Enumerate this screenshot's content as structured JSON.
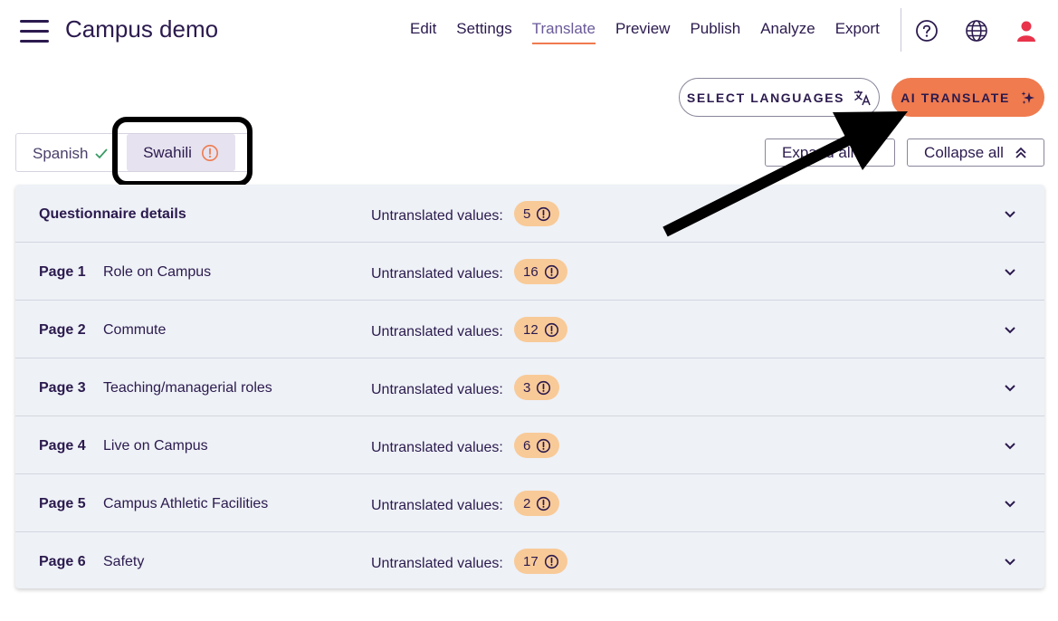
{
  "app": {
    "title": "Campus demo"
  },
  "nav": {
    "items": [
      {
        "label": "Edit"
      },
      {
        "label": "Settings"
      },
      {
        "label": "Translate",
        "active": true
      },
      {
        "label": "Preview"
      },
      {
        "label": "Publish"
      },
      {
        "label": "Analyze"
      },
      {
        "label": "Export"
      }
    ],
    "icons": [
      "help-icon",
      "globe-icon",
      "user-icon"
    ]
  },
  "actions": {
    "select_languages": "SELECT LANGUAGES",
    "ai_translate": "AI TRANSLATE"
  },
  "languages": {
    "tabs": [
      {
        "label": "Spanish",
        "status": "complete"
      },
      {
        "label": "Swahili",
        "status": "warning",
        "selected": true
      }
    ]
  },
  "controls": {
    "expand_all": "Expand all",
    "collapse_all": "Collapse all"
  },
  "sections": {
    "untranslated_label": "Untranslated values:",
    "rows": [
      {
        "page": "Questionnaire details",
        "title": "",
        "count": "5"
      },
      {
        "page": "Page 1",
        "title": "Role on Campus",
        "count": "16"
      },
      {
        "page": "Page 2",
        "title": "Commute",
        "count": "12"
      },
      {
        "page": "Page 3",
        "title": "Teaching/managerial roles",
        "count": "3"
      },
      {
        "page": "Page 4",
        "title": "Live on Campus",
        "count": "6"
      },
      {
        "page": "Page 5",
        "title": "Campus Athletic Facilities",
        "count": "2"
      },
      {
        "page": "Page 6",
        "title": "Safety",
        "count": "17"
      }
    ]
  },
  "colors": {
    "accent": "#ef7b4f",
    "text": "#2b1a4e",
    "badge": "#f8ca98",
    "panel": "#eef1f6"
  }
}
